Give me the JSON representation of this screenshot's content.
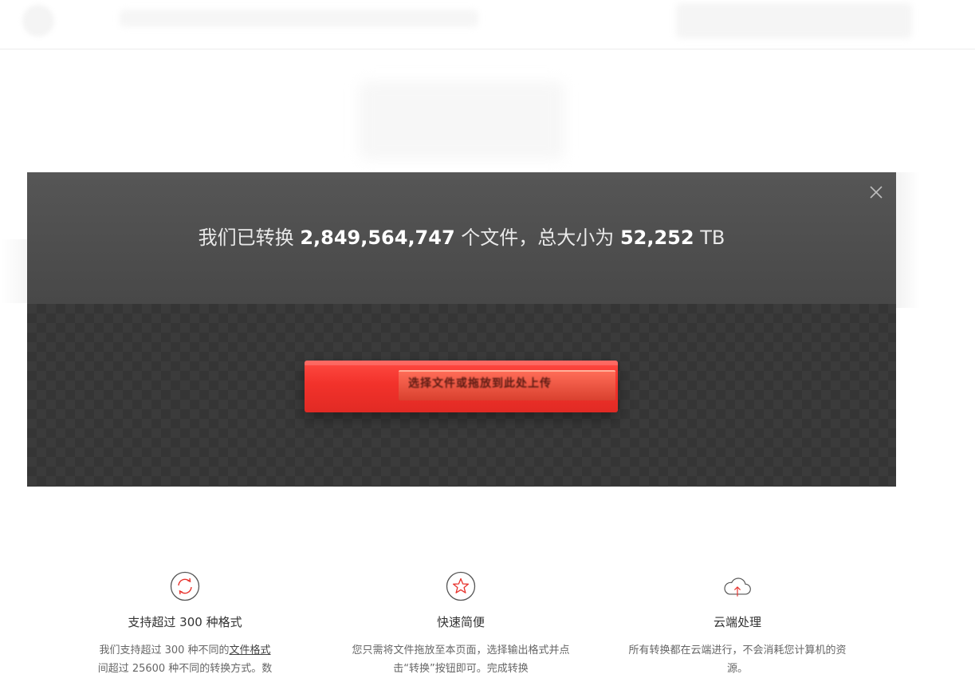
{
  "stats": {
    "prefix": "我们已转换",
    "file_count": "2,849,564,747",
    "middle": "个文件，总大小为",
    "total_size": "52,252",
    "unit": "TB"
  },
  "upload": {
    "label": "选择文件或拖放到此处上传"
  },
  "features": [
    {
      "icon": "refresh-icon",
      "title": "支持超过 300 种格式",
      "desc_before": "我们支持超过 300 种不同的",
      "desc_link": "文件格式",
      "desc_after": "间超过 25600 种不同的转换方式。数"
    },
    {
      "icon": "star-icon",
      "title": "快速简便",
      "desc": "您只需将文件拖放至本页面，选择输出格式并点击“转换”按钮即可。完成转换"
    },
    {
      "icon": "cloud-upload-icon",
      "title": "云端处理",
      "desc": "所有转换都在云端进行，不会消耗您计算机的资源。"
    }
  ],
  "colors": {
    "accent": "#e8322c",
    "header_bg": "#505050",
    "body_bg": "#3b3b3b"
  }
}
